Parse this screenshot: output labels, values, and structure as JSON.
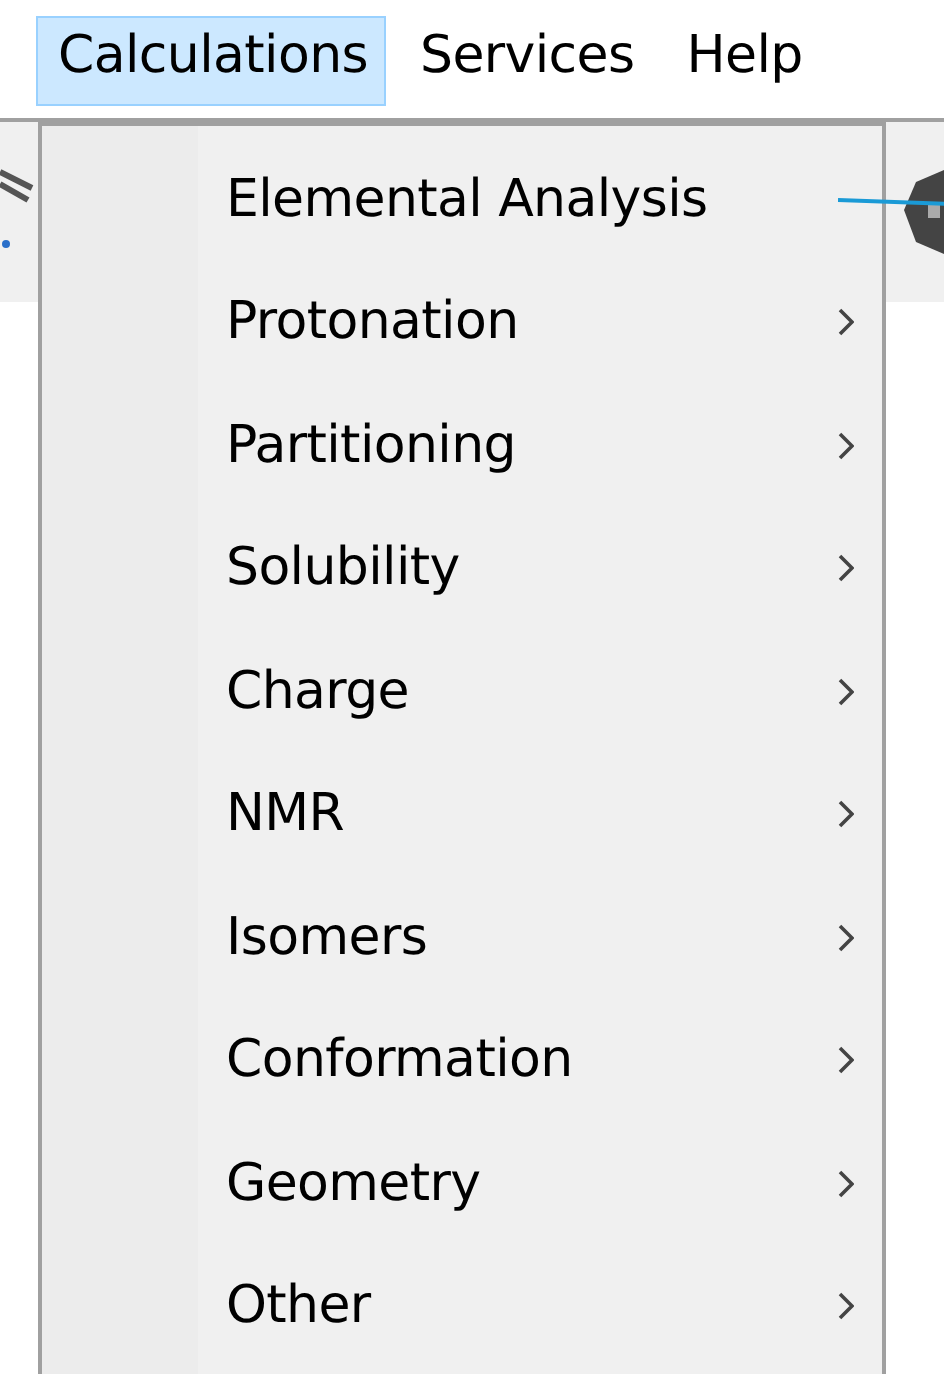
{
  "menubar": [
    {
      "label": "Calculations",
      "selected": true
    },
    {
      "label": "Services",
      "selected": false
    },
    {
      "label": "Help",
      "selected": false
    }
  ],
  "menu": {
    "items": [
      {
        "label": "Elemental Analysis",
        "submenu": false
      },
      {
        "label": "Protonation",
        "submenu": true
      },
      {
        "label": "Partitioning",
        "submenu": true
      },
      {
        "label": "Solubility",
        "submenu": true
      },
      {
        "label": "Charge",
        "submenu": true
      },
      {
        "label": "NMR",
        "submenu": true
      },
      {
        "label": "Isomers",
        "submenu": true
      },
      {
        "label": "Conformation",
        "submenu": true
      },
      {
        "label": "Geometry",
        "submenu": true
      },
      {
        "label": "Other",
        "submenu": true
      }
    ]
  }
}
